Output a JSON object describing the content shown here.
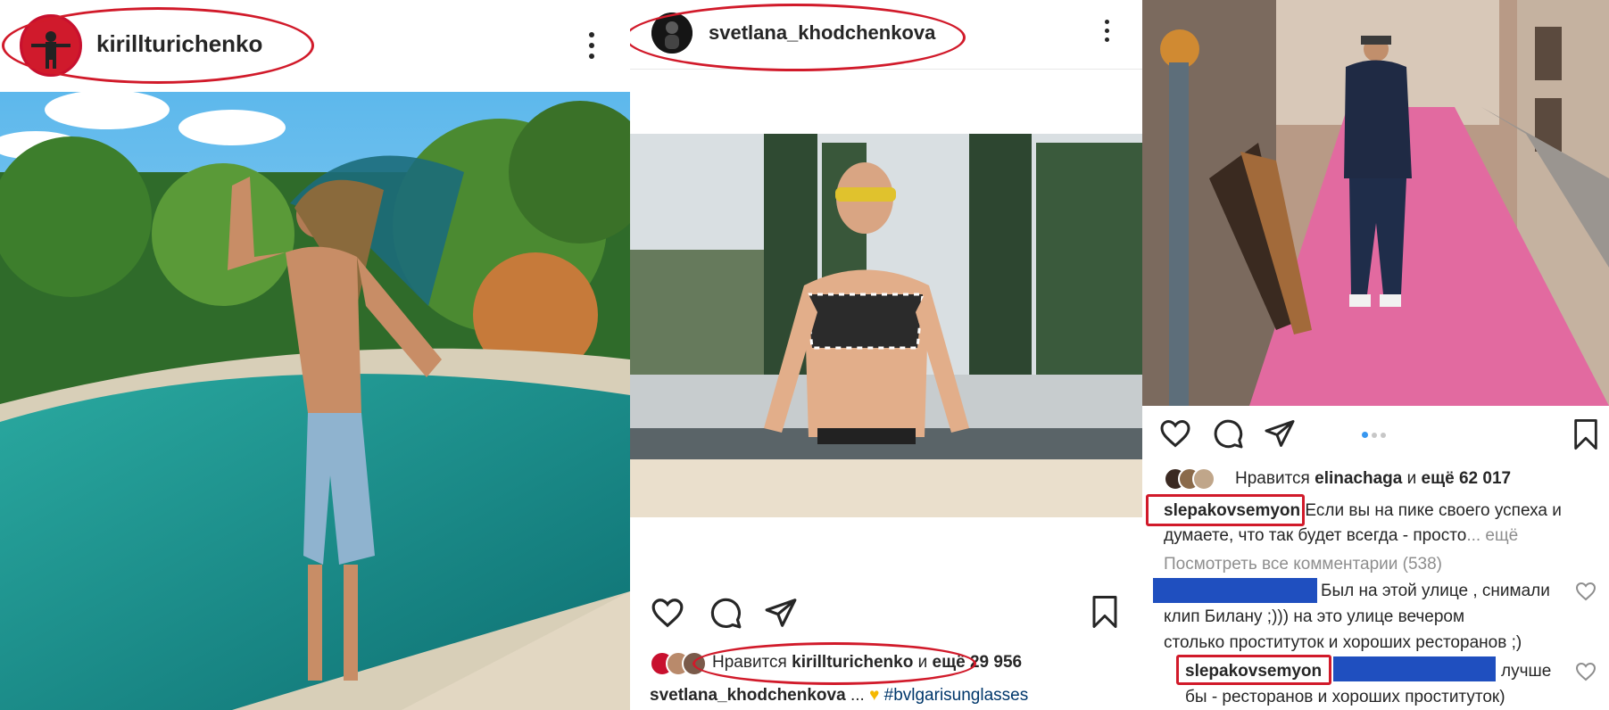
{
  "post1": {
    "username": "kirillturichenko"
  },
  "post2": {
    "username": "svetlana_khodchenkova",
    "likes_prefix": "Нравится",
    "likes_user": "kirillturichenko",
    "likes_and": "и",
    "likes_count": "ещё 29 956",
    "caption_user": "svetlana_khodchenkova",
    "caption_ellipsis": "...",
    "caption_hashtag": "#bvlgarisunglasses"
  },
  "post3": {
    "likes_prefix": "Нравится",
    "likes_user": "elinachaga",
    "likes_and": "и",
    "likes_count": "ещё 62 017",
    "caption_user": "slepakovsemyon",
    "caption_text_1": "Если вы на пике своего успеха и",
    "caption_text_2": "думаете, что так будет всегда - просто",
    "caption_more": "... ещё",
    "view_all": "Посмотреть все комментарии (538)",
    "comment1_line1": "Был на этой улице , снимали",
    "comment1_line2": "клип Билану ;))) на это улице вечером",
    "comment1_line3": "столько проституток и хороших ресторанов ;)",
    "reply_user": "slepakovsemyon",
    "reply_line1": "лучше",
    "reply_line2": "бы - ресторанов и хороших проституток)"
  },
  "colors": {
    "highlight": "#d11a2a",
    "redaction": "#1f4fbf",
    "pink_street": "#e26aa0",
    "pool": "#3fb3a8",
    "sky": "#7ec8ef"
  },
  "icons": [
    "heart-icon",
    "comment-icon",
    "share-icon",
    "bookmark-icon",
    "more-options-icon",
    "carousel-dots"
  ]
}
